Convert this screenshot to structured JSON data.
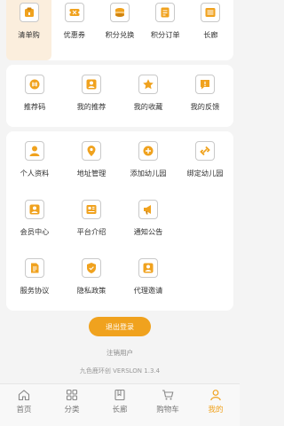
{
  "accent": "#f0a21e",
  "quick": [
    {
      "label": "清单购",
      "icon": "shopping-list-icon",
      "active": true
    },
    {
      "label": "优惠券",
      "icon": "coupon-icon"
    },
    {
      "label": "积分兑换",
      "icon": "points-exchange-icon"
    },
    {
      "label": "积分订单",
      "icon": "points-order-icon"
    },
    {
      "label": "长廊",
      "icon": "gallery-icon"
    }
  ],
  "row2": [
    {
      "label": "推荐码",
      "icon": "referral-code-icon"
    },
    {
      "label": "我的推荐",
      "icon": "my-referrals-icon"
    },
    {
      "label": "我的收藏",
      "icon": "star-icon"
    },
    {
      "label": "我的反馈",
      "icon": "feedback-icon"
    }
  ],
  "services": [
    {
      "label": "个人资料",
      "icon": "profile-icon"
    },
    {
      "label": "地址管理",
      "icon": "location-pin-icon"
    },
    {
      "label": "添加幼儿园",
      "icon": "add-icon"
    },
    {
      "label": "绑定幼儿园",
      "icon": "link-icon"
    },
    {
      "label": "会员中心",
      "icon": "member-icon"
    },
    {
      "label": "平台介绍",
      "icon": "platform-info-icon"
    },
    {
      "label": "通知公告",
      "icon": "megaphone-icon"
    },
    {
      "label": "服务协议",
      "icon": "agreement-icon"
    },
    {
      "label": "隐私政策",
      "icon": "shield-icon"
    },
    {
      "label": "代理邀请",
      "icon": "agent-invite-icon"
    }
  ],
  "logout_label": "退出登录",
  "cancel_label": "注销用户",
  "version_text": "九色鹿环创 VERSLON 1.3.4",
  "tabs": [
    {
      "label": "首页",
      "icon": "home-icon"
    },
    {
      "label": "分类",
      "icon": "category-icon"
    },
    {
      "label": "长廊",
      "icon": "gallery-tab-icon"
    },
    {
      "label": "购物车",
      "icon": "cart-icon"
    },
    {
      "label": "我的",
      "icon": "person-icon",
      "active": true
    }
  ]
}
